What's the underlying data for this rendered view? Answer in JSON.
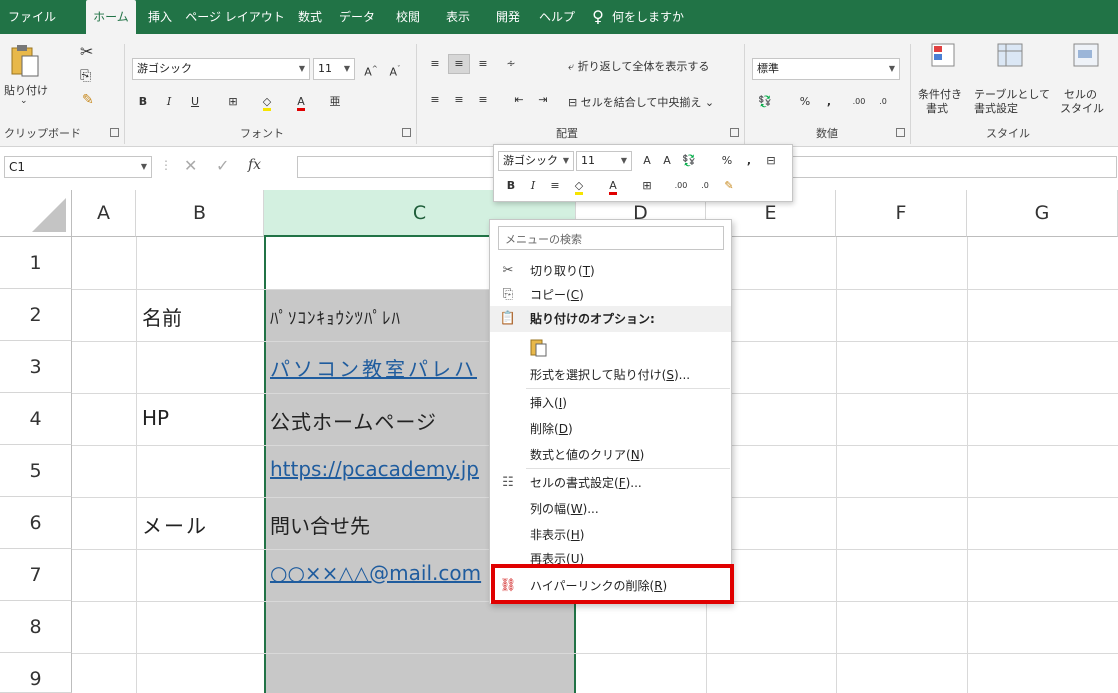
{
  "menu": {
    "tabs": [
      "ファイル",
      "ホーム",
      "挿入",
      "ページ レイアウト",
      "数式",
      "データ",
      "校閲",
      "表示",
      "開発",
      "ヘルプ"
    ],
    "tell_me": "何をしますか"
  },
  "ribbon": {
    "paste_label": "貼り付け",
    "clipboard_group": "クリップボード",
    "font_name": "游ゴシック",
    "font_size": "11",
    "font_group": "フォント",
    "wrap_text": "折り返して全体を表示する",
    "merge_center": "セルを結合して中央揃え",
    "alignment_group": "配置",
    "number_format": "標準",
    "number_group": "数値",
    "cond_format": [
      "条件付き",
      "書式"
    ],
    "table_format": [
      "テーブルとして",
      "書式設定"
    ],
    "cell_styles": [
      "セルの",
      "スタイル"
    ],
    "styles_group": "スタイル"
  },
  "formula_bar": {
    "name_box": "C1",
    "fx": "fx"
  },
  "mini_toolbar": {
    "font_name": "游ゴシック",
    "font_size": "11"
  },
  "columns": [
    "A",
    "B",
    "C",
    "D",
    "E",
    "F",
    "G"
  ],
  "rows": [
    "1",
    "2",
    "3",
    "4",
    "5",
    "6",
    "7",
    "8",
    "9"
  ],
  "cells": {
    "B2": "名前",
    "C2": "ﾊﾟｿｺﾝｷｮｳｼﾂﾊﾟﾚﾊ",
    "C3": "パソコン教室パレハ",
    "B4": "HP",
    "C4": "公式ホームページ",
    "C5": "https://pcacademy.jp",
    "B6": "メール",
    "C6": "問い合せ先",
    "C7": "○○××△△@mail.com"
  },
  "context_menu": {
    "search_placeholder": "メニューの検索",
    "items": [
      {
        "label": "切り取り(",
        "key": "T",
        "tail": ")"
      },
      {
        "label": "コピー(",
        "key": "C",
        "tail": ")"
      },
      {
        "label": "貼り付けのオプション:",
        "key": "",
        "tail": ""
      },
      {
        "label": "形式を選択して貼り付け(",
        "key": "S",
        "tail": ")..."
      },
      {
        "label": "挿入(",
        "key": "I",
        "tail": ")"
      },
      {
        "label": "削除(",
        "key": "D",
        "tail": ")"
      },
      {
        "label": "数式と値のクリア(",
        "key": "N",
        "tail": ")"
      },
      {
        "label": "セルの書式設定(",
        "key": "F",
        "tail": ")..."
      },
      {
        "label": "列の幅(",
        "key": "W",
        "tail": ")..."
      },
      {
        "label": "非表示(",
        "key": "H",
        "tail": ")"
      },
      {
        "label": "再表示(",
        "key": "U",
        "tail": ")"
      },
      {
        "label": "ハイパーリンクの削除(",
        "key": "R",
        "tail": ")"
      }
    ]
  },
  "colors": {
    "excel_green": "#217346",
    "highlight_red": "#e00000",
    "selection_gray": "#c8c8c8",
    "link_blue": "#1f5c9e"
  }
}
